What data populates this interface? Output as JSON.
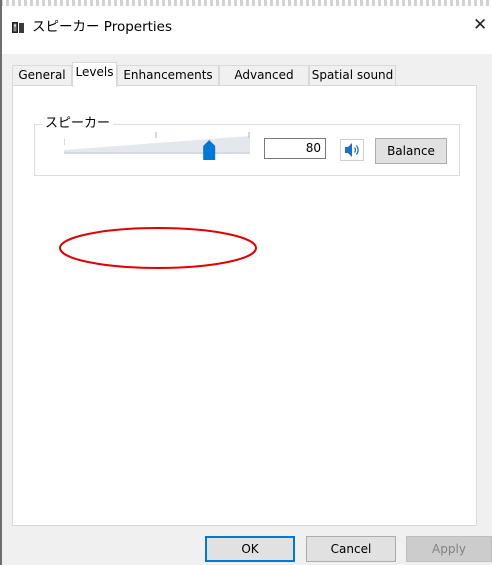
{
  "window": {
    "title": "スピーカー Properties",
    "close_glyph": "✕",
    "app_icon": "speaker-icon"
  },
  "tabs": [
    {
      "label": "General",
      "active": false
    },
    {
      "label": "Levels",
      "active": true
    },
    {
      "label": "Enhancements",
      "active": false
    },
    {
      "label": "Advanced",
      "active": false
    },
    {
      "label": "Spatial sound",
      "active": false
    }
  ],
  "levels": {
    "device_label": "スピーカー",
    "volume_value": "80",
    "volume_fraction": 0.8,
    "mute_icon": "speaker-volume-icon",
    "balance_label": "Balance"
  },
  "footer": {
    "ok_label": "OK",
    "cancel_label": "Cancel",
    "apply_label": "Apply"
  },
  "colors": {
    "accent": "#0078d7",
    "annotation": "#e00000",
    "dialog_bg": "#f0f0f0",
    "panel_bg": "#ffffff"
  }
}
